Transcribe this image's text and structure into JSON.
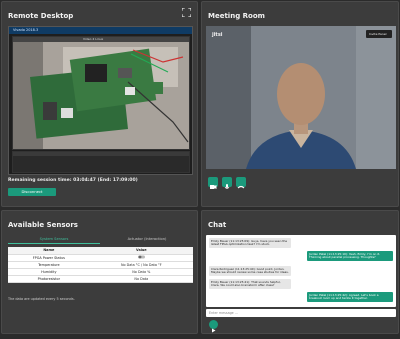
{
  "remote": {
    "title": "Remote Desktop",
    "screen_bar": "Vivado 2018.3",
    "window_title": "Video 4 Linux",
    "session_text": "Remaining session time: 03:04:47 (End: 17:09:00)",
    "disconnect_label": "Disconnect"
  },
  "meeting": {
    "title": "Meeting Room",
    "brand": "jitsi",
    "invite_label": "Invite Panel"
  },
  "sensors": {
    "title": "Available Sensors",
    "tab_active": "System Sensors",
    "tab_inactive": "Actuator (Interaction)",
    "col_name": "Name",
    "col_value": "Value",
    "rows": [
      {
        "name": "FPGA Power Status",
        "value": ""
      },
      {
        "name": "Temperature",
        "value": "No Data °C / No Data °F"
      },
      {
        "name": "Humidity",
        "value": "No Data %"
      },
      {
        "name": "Photoresistor",
        "value": "No Data"
      }
    ],
    "note": "The data are updated every 5 seconds."
  },
  "chat": {
    "title": "Chat",
    "messages": [
      {
        "dir": "in",
        "text": "Emily Bauer (11:13:25:09): Guys, have you seen the latest FPGA optimization task? I'm stuck."
      },
      {
        "dir": "out",
        "text": "Jordan Patel (11:13:25:10): Yeah, Emily, I'm on it. Thinking about parallel processing. Thoughts?"
      },
      {
        "dir": "in",
        "text": "Clara Rodriguez (11:13:25:40): Good point, Jordan. Maybe we should review some case studies for ideas."
      },
      {
        "dir": "in",
        "text": "Emily Bauer (11:13:25:41): That sounds helpful, Clara. We could also brainstorm after class?"
      },
      {
        "dir": "out",
        "text": "Jordan Patel (11:13:25:42): Agreed. Let's book a breakout room up and tackle it together."
      }
    ],
    "placeholder": "Enter message ..."
  }
}
